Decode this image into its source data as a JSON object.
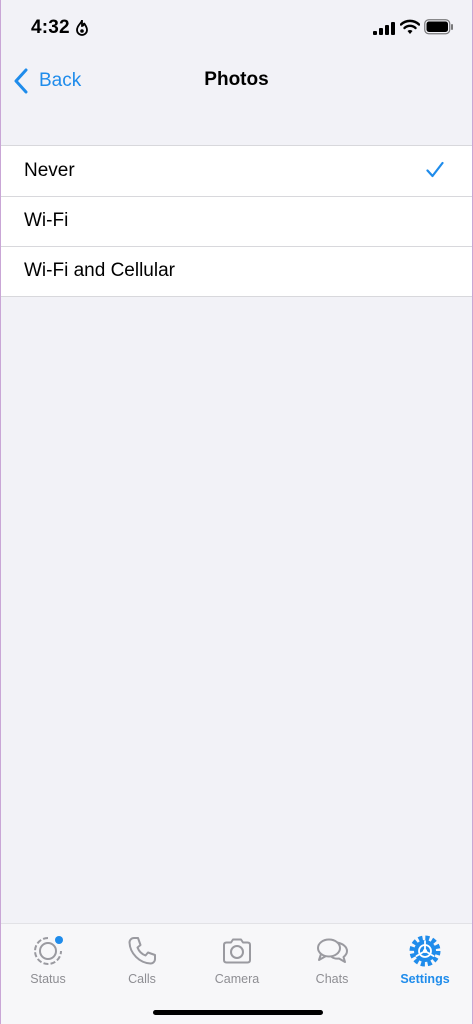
{
  "status_bar": {
    "time": "4:32"
  },
  "nav": {
    "back_label": "Back",
    "title": "Photos"
  },
  "options": [
    {
      "label": "Never",
      "selected": true
    },
    {
      "label": "Wi-Fi",
      "selected": false
    },
    {
      "label": "Wi-Fi and Cellular",
      "selected": false
    }
  ],
  "tabs": [
    {
      "label": "Status",
      "icon": "status-icon"
    },
    {
      "label": "Calls",
      "icon": "phone-icon"
    },
    {
      "label": "Camera",
      "icon": "camera-icon"
    },
    {
      "label": "Chats",
      "icon": "chats-icon"
    },
    {
      "label": "Settings",
      "icon": "gear-icon",
      "active": true
    }
  ],
  "colors": {
    "accent": "#1f8ceb",
    "inactive": "#8e8e93",
    "background": "#f2f2f7"
  }
}
